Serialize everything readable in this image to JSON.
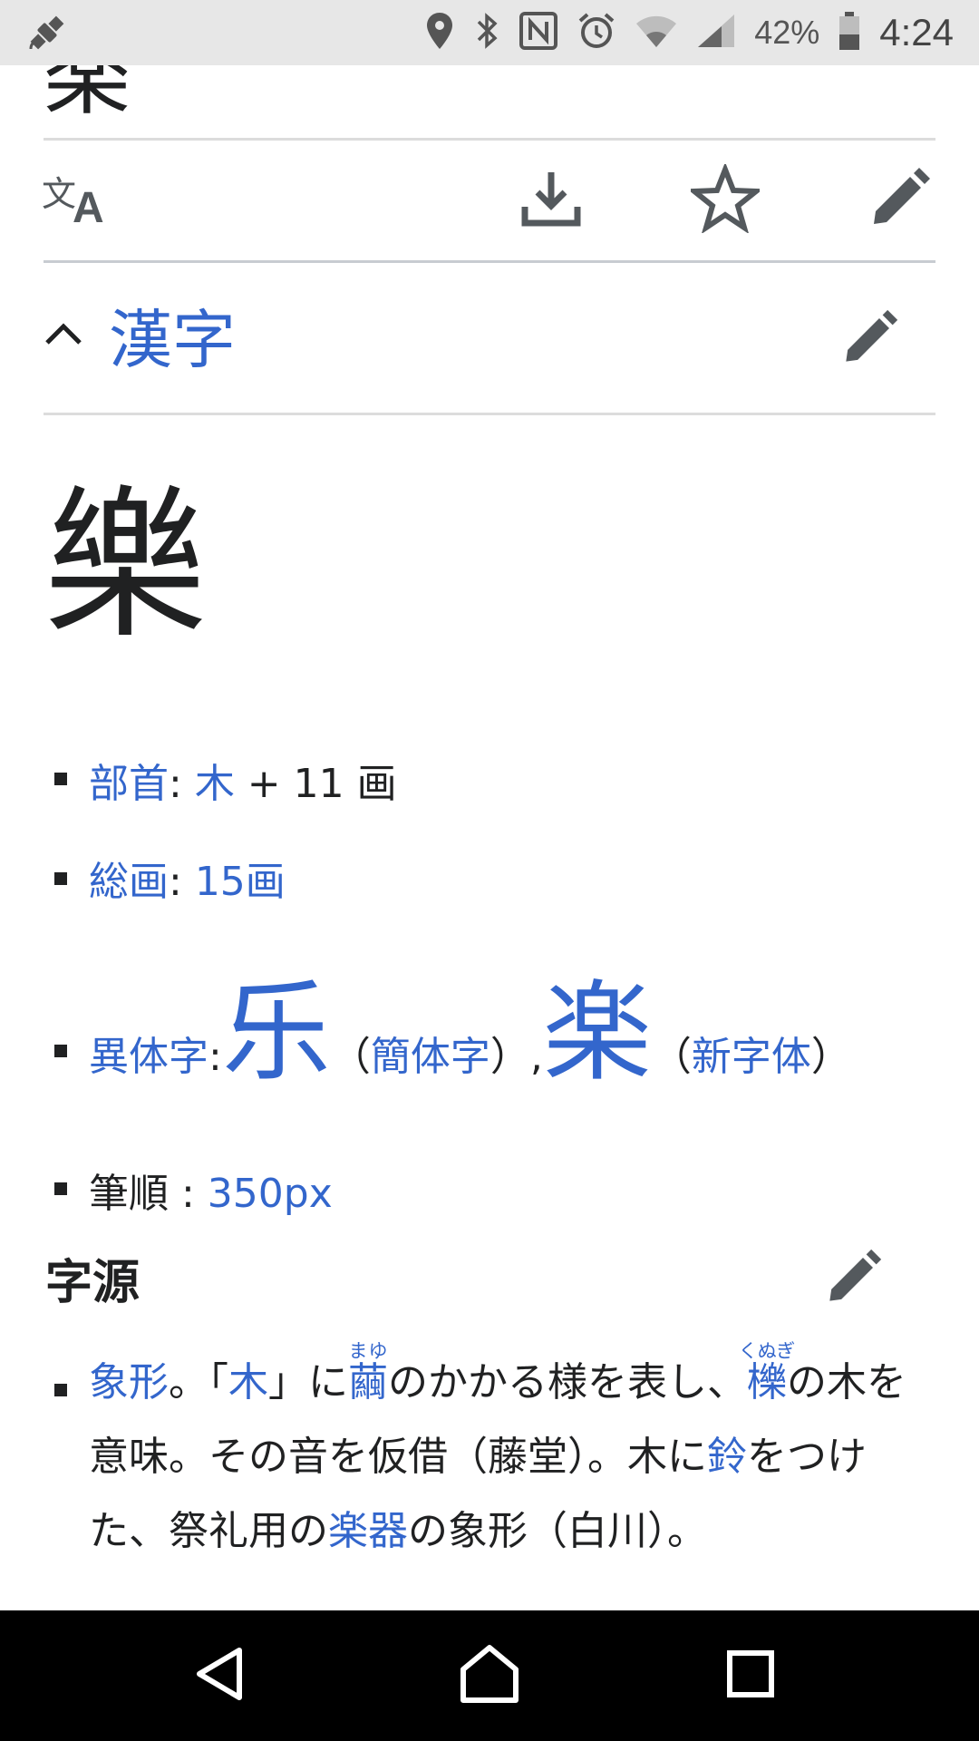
{
  "status_bar": {
    "battery_percent": "42%",
    "time": "4:24",
    "icons": [
      "satellite-icon",
      "location-icon",
      "bluetooth-icon",
      "nfc-icon",
      "alarm-icon",
      "wifi-icon",
      "signal-icon",
      "battery-icon"
    ]
  },
  "page": {
    "cut_title": "楽"
  },
  "actions": {
    "icons": [
      "translate-icon",
      "download-icon",
      "star-icon",
      "edit-icon"
    ]
  },
  "section": {
    "title": "漢字",
    "character": "樂"
  },
  "info": {
    "radical_label": "部首",
    "radical_sep": ": ",
    "radical_value": "木",
    "radical_strokes": " + 11 画",
    "total_label": "総画",
    "total_sep": ": ",
    "total_value": "15画",
    "variant_label": "異体字",
    "variant_sep": " : ",
    "variant1_char": "乐",
    "paren_open": "（",
    "variant1_type": "簡体字",
    "paren_close": "）",
    "comma": " , ",
    "variant2_char": "楽",
    "variant2_type": "新字体",
    "stroke_order_label": "筆順",
    "stroke_order_sep": " : ",
    "stroke_order_value": "350px"
  },
  "etymology": {
    "heading": "字源",
    "p1": "象形",
    "p2": "。「",
    "p3": "木",
    "p4": "」に",
    "p5": "繭",
    "p5_ruby": "まゆ",
    "p6": "のかかる様を表し、",
    "p7": "櫟",
    "p7_ruby": "くぬぎ",
    "p8": "の木を意味。その音を仮借（藤堂）。木に",
    "p9": "鈴",
    "p10": "をつけた、祭礼用の",
    "p11": "楽器",
    "p12": "の象形（白川）。"
  },
  "colors": {
    "link": "#3366cc",
    "text": "#202122",
    "icon": "#54595d",
    "status_bar_bg": "#e7e7e7",
    "nav_bar_bg": "#000000"
  }
}
